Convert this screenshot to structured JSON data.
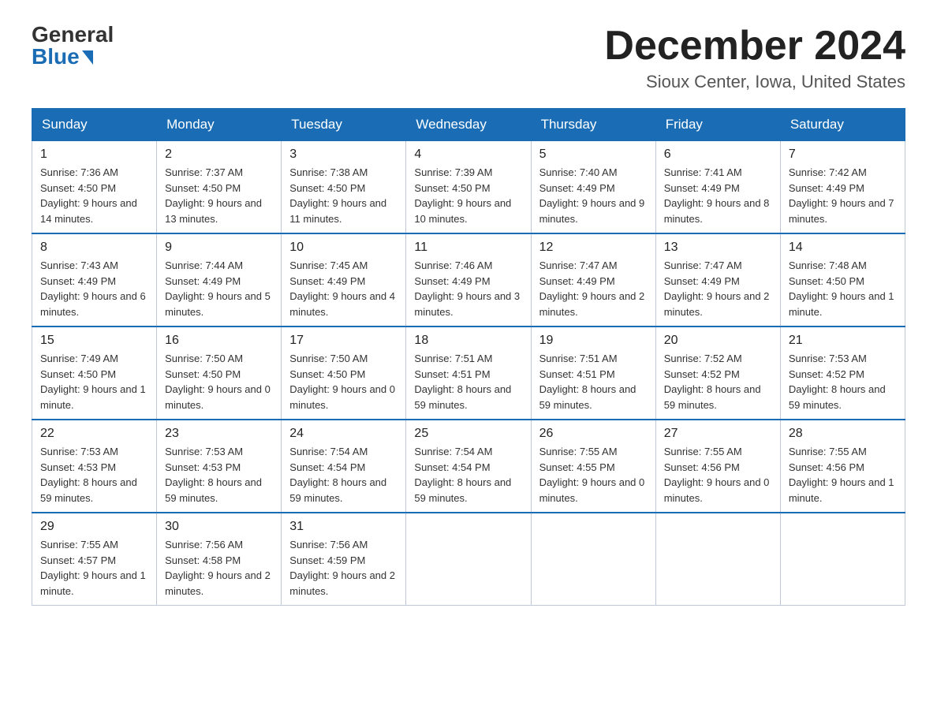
{
  "header": {
    "logo_general": "General",
    "logo_blue": "Blue",
    "month": "December 2024",
    "location": "Sioux Center, Iowa, United States"
  },
  "days_of_week": [
    "Sunday",
    "Monday",
    "Tuesday",
    "Wednesday",
    "Thursday",
    "Friday",
    "Saturday"
  ],
  "weeks": [
    [
      {
        "day": "1",
        "sunrise": "7:36 AM",
        "sunset": "4:50 PM",
        "daylight": "9 hours and 14 minutes."
      },
      {
        "day": "2",
        "sunrise": "7:37 AM",
        "sunset": "4:50 PM",
        "daylight": "9 hours and 13 minutes."
      },
      {
        "day": "3",
        "sunrise": "7:38 AM",
        "sunset": "4:50 PM",
        "daylight": "9 hours and 11 minutes."
      },
      {
        "day": "4",
        "sunrise": "7:39 AM",
        "sunset": "4:50 PM",
        "daylight": "9 hours and 10 minutes."
      },
      {
        "day": "5",
        "sunrise": "7:40 AM",
        "sunset": "4:49 PM",
        "daylight": "9 hours and 9 minutes."
      },
      {
        "day": "6",
        "sunrise": "7:41 AM",
        "sunset": "4:49 PM",
        "daylight": "9 hours and 8 minutes."
      },
      {
        "day": "7",
        "sunrise": "7:42 AM",
        "sunset": "4:49 PM",
        "daylight": "9 hours and 7 minutes."
      }
    ],
    [
      {
        "day": "8",
        "sunrise": "7:43 AM",
        "sunset": "4:49 PM",
        "daylight": "9 hours and 6 minutes."
      },
      {
        "day": "9",
        "sunrise": "7:44 AM",
        "sunset": "4:49 PM",
        "daylight": "9 hours and 5 minutes."
      },
      {
        "day": "10",
        "sunrise": "7:45 AM",
        "sunset": "4:49 PM",
        "daylight": "9 hours and 4 minutes."
      },
      {
        "day": "11",
        "sunrise": "7:46 AM",
        "sunset": "4:49 PM",
        "daylight": "9 hours and 3 minutes."
      },
      {
        "day": "12",
        "sunrise": "7:47 AM",
        "sunset": "4:49 PM",
        "daylight": "9 hours and 2 minutes."
      },
      {
        "day": "13",
        "sunrise": "7:47 AM",
        "sunset": "4:49 PM",
        "daylight": "9 hours and 2 minutes."
      },
      {
        "day": "14",
        "sunrise": "7:48 AM",
        "sunset": "4:50 PM",
        "daylight": "9 hours and 1 minute."
      }
    ],
    [
      {
        "day": "15",
        "sunrise": "7:49 AM",
        "sunset": "4:50 PM",
        "daylight": "9 hours and 1 minute."
      },
      {
        "day": "16",
        "sunrise": "7:50 AM",
        "sunset": "4:50 PM",
        "daylight": "9 hours and 0 minutes."
      },
      {
        "day": "17",
        "sunrise": "7:50 AM",
        "sunset": "4:50 PM",
        "daylight": "9 hours and 0 minutes."
      },
      {
        "day": "18",
        "sunrise": "7:51 AM",
        "sunset": "4:51 PM",
        "daylight": "8 hours and 59 minutes."
      },
      {
        "day": "19",
        "sunrise": "7:51 AM",
        "sunset": "4:51 PM",
        "daylight": "8 hours and 59 minutes."
      },
      {
        "day": "20",
        "sunrise": "7:52 AM",
        "sunset": "4:52 PM",
        "daylight": "8 hours and 59 minutes."
      },
      {
        "day": "21",
        "sunrise": "7:53 AM",
        "sunset": "4:52 PM",
        "daylight": "8 hours and 59 minutes."
      }
    ],
    [
      {
        "day": "22",
        "sunrise": "7:53 AM",
        "sunset": "4:53 PM",
        "daylight": "8 hours and 59 minutes."
      },
      {
        "day": "23",
        "sunrise": "7:53 AM",
        "sunset": "4:53 PM",
        "daylight": "8 hours and 59 minutes."
      },
      {
        "day": "24",
        "sunrise": "7:54 AM",
        "sunset": "4:54 PM",
        "daylight": "8 hours and 59 minutes."
      },
      {
        "day": "25",
        "sunrise": "7:54 AM",
        "sunset": "4:54 PM",
        "daylight": "8 hours and 59 minutes."
      },
      {
        "day": "26",
        "sunrise": "7:55 AM",
        "sunset": "4:55 PM",
        "daylight": "9 hours and 0 minutes."
      },
      {
        "day": "27",
        "sunrise": "7:55 AM",
        "sunset": "4:56 PM",
        "daylight": "9 hours and 0 minutes."
      },
      {
        "day": "28",
        "sunrise": "7:55 AM",
        "sunset": "4:56 PM",
        "daylight": "9 hours and 1 minute."
      }
    ],
    [
      {
        "day": "29",
        "sunrise": "7:55 AM",
        "sunset": "4:57 PM",
        "daylight": "9 hours and 1 minute."
      },
      {
        "day": "30",
        "sunrise": "7:56 AM",
        "sunset": "4:58 PM",
        "daylight": "9 hours and 2 minutes."
      },
      {
        "day": "31",
        "sunrise": "7:56 AM",
        "sunset": "4:59 PM",
        "daylight": "9 hours and 2 minutes."
      },
      null,
      null,
      null,
      null
    ]
  ]
}
